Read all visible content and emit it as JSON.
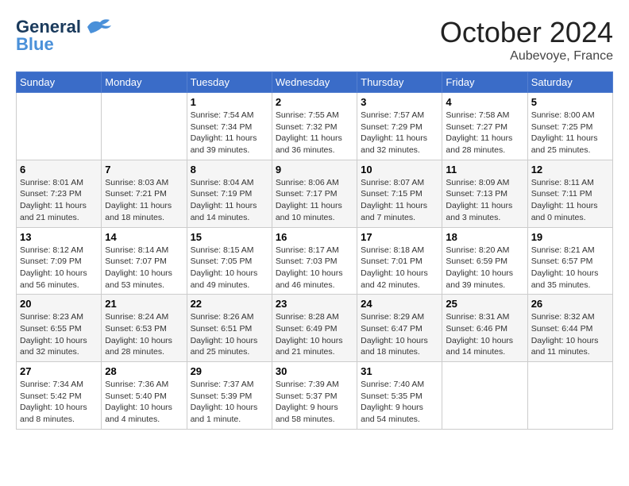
{
  "header": {
    "logo_text_part1": "General",
    "logo_text_part2": "Blue",
    "month": "October 2024",
    "location": "Aubevoye, France"
  },
  "weekdays": [
    "Sunday",
    "Monday",
    "Tuesday",
    "Wednesday",
    "Thursday",
    "Friday",
    "Saturday"
  ],
  "weeks": [
    [
      {
        "day": "",
        "info": ""
      },
      {
        "day": "",
        "info": ""
      },
      {
        "day": "1",
        "info": "Sunrise: 7:54 AM\nSunset: 7:34 PM\nDaylight: 11 hours\nand 39 minutes."
      },
      {
        "day": "2",
        "info": "Sunrise: 7:55 AM\nSunset: 7:32 PM\nDaylight: 11 hours\nand 36 minutes."
      },
      {
        "day": "3",
        "info": "Sunrise: 7:57 AM\nSunset: 7:29 PM\nDaylight: 11 hours\nand 32 minutes."
      },
      {
        "day": "4",
        "info": "Sunrise: 7:58 AM\nSunset: 7:27 PM\nDaylight: 11 hours\nand 28 minutes."
      },
      {
        "day": "5",
        "info": "Sunrise: 8:00 AM\nSunset: 7:25 PM\nDaylight: 11 hours\nand 25 minutes."
      }
    ],
    [
      {
        "day": "6",
        "info": "Sunrise: 8:01 AM\nSunset: 7:23 PM\nDaylight: 11 hours\nand 21 minutes."
      },
      {
        "day": "7",
        "info": "Sunrise: 8:03 AM\nSunset: 7:21 PM\nDaylight: 11 hours\nand 18 minutes."
      },
      {
        "day": "8",
        "info": "Sunrise: 8:04 AM\nSunset: 7:19 PM\nDaylight: 11 hours\nand 14 minutes."
      },
      {
        "day": "9",
        "info": "Sunrise: 8:06 AM\nSunset: 7:17 PM\nDaylight: 11 hours\nand 10 minutes."
      },
      {
        "day": "10",
        "info": "Sunrise: 8:07 AM\nSunset: 7:15 PM\nDaylight: 11 hours\nand 7 minutes."
      },
      {
        "day": "11",
        "info": "Sunrise: 8:09 AM\nSunset: 7:13 PM\nDaylight: 11 hours\nand 3 minutes."
      },
      {
        "day": "12",
        "info": "Sunrise: 8:11 AM\nSunset: 7:11 PM\nDaylight: 11 hours\nand 0 minutes."
      }
    ],
    [
      {
        "day": "13",
        "info": "Sunrise: 8:12 AM\nSunset: 7:09 PM\nDaylight: 10 hours\nand 56 minutes."
      },
      {
        "day": "14",
        "info": "Sunrise: 8:14 AM\nSunset: 7:07 PM\nDaylight: 10 hours\nand 53 minutes."
      },
      {
        "day": "15",
        "info": "Sunrise: 8:15 AM\nSunset: 7:05 PM\nDaylight: 10 hours\nand 49 minutes."
      },
      {
        "day": "16",
        "info": "Sunrise: 8:17 AM\nSunset: 7:03 PM\nDaylight: 10 hours\nand 46 minutes."
      },
      {
        "day": "17",
        "info": "Sunrise: 8:18 AM\nSunset: 7:01 PM\nDaylight: 10 hours\nand 42 minutes."
      },
      {
        "day": "18",
        "info": "Sunrise: 8:20 AM\nSunset: 6:59 PM\nDaylight: 10 hours\nand 39 minutes."
      },
      {
        "day": "19",
        "info": "Sunrise: 8:21 AM\nSunset: 6:57 PM\nDaylight: 10 hours\nand 35 minutes."
      }
    ],
    [
      {
        "day": "20",
        "info": "Sunrise: 8:23 AM\nSunset: 6:55 PM\nDaylight: 10 hours\nand 32 minutes."
      },
      {
        "day": "21",
        "info": "Sunrise: 8:24 AM\nSunset: 6:53 PM\nDaylight: 10 hours\nand 28 minutes."
      },
      {
        "day": "22",
        "info": "Sunrise: 8:26 AM\nSunset: 6:51 PM\nDaylight: 10 hours\nand 25 minutes."
      },
      {
        "day": "23",
        "info": "Sunrise: 8:28 AM\nSunset: 6:49 PM\nDaylight: 10 hours\nand 21 minutes."
      },
      {
        "day": "24",
        "info": "Sunrise: 8:29 AM\nSunset: 6:47 PM\nDaylight: 10 hours\nand 18 minutes."
      },
      {
        "day": "25",
        "info": "Sunrise: 8:31 AM\nSunset: 6:46 PM\nDaylight: 10 hours\nand 14 minutes."
      },
      {
        "day": "26",
        "info": "Sunrise: 8:32 AM\nSunset: 6:44 PM\nDaylight: 10 hours\nand 11 minutes."
      }
    ],
    [
      {
        "day": "27",
        "info": "Sunrise: 7:34 AM\nSunset: 5:42 PM\nDaylight: 10 hours\nand 8 minutes."
      },
      {
        "day": "28",
        "info": "Sunrise: 7:36 AM\nSunset: 5:40 PM\nDaylight: 10 hours\nand 4 minutes."
      },
      {
        "day": "29",
        "info": "Sunrise: 7:37 AM\nSunset: 5:39 PM\nDaylight: 10 hours\nand 1 minute."
      },
      {
        "day": "30",
        "info": "Sunrise: 7:39 AM\nSunset: 5:37 PM\nDaylight: 9 hours\nand 58 minutes."
      },
      {
        "day": "31",
        "info": "Sunrise: 7:40 AM\nSunset: 5:35 PM\nDaylight: 9 hours\nand 54 minutes."
      },
      {
        "day": "",
        "info": ""
      },
      {
        "day": "",
        "info": ""
      }
    ]
  ]
}
